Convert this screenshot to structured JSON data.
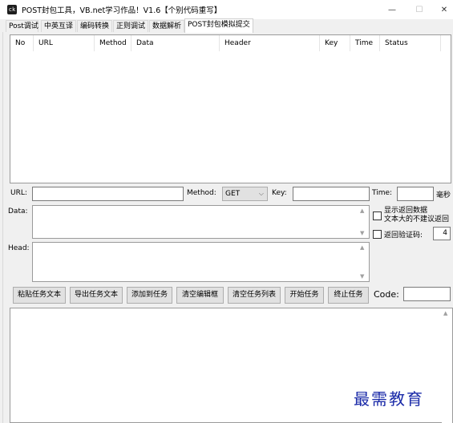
{
  "window": {
    "title": "POST封包工具，VB.net学习作品！V1.6【个别代码重写】",
    "icon_label": "ck",
    "minimize_glyph": "—",
    "maximize_glyph": "☐",
    "close_glyph": "✕"
  },
  "tabs": [
    {
      "label": "Post调试"
    },
    {
      "label": "中英互译"
    },
    {
      "label": "编码转换"
    },
    {
      "label": "正则调试"
    },
    {
      "label": "数据解析"
    },
    {
      "label": "POST封包模拟提交",
      "active": true
    }
  ],
  "task_list": {
    "columns": [
      "No",
      "URL",
      "Method",
      "Data",
      "Header",
      "Key",
      "Time",
      "Status"
    ]
  },
  "request": {
    "url_label": "URL:",
    "url_value": "",
    "method_label": "Method:",
    "method_value": "GET",
    "key_label": "Key:",
    "key_value": "",
    "time_label": "Time:",
    "time_value": "",
    "time_unit": "毫秒",
    "data_label": "Data:",
    "data_value": "",
    "head_label": "Head:",
    "head_value": ""
  },
  "options": {
    "show_return_line1": "显示返回数据",
    "show_return_line2": "文本大的不建议返回",
    "show_return_checked": false,
    "return_captcha_label": "返回验证码:",
    "return_captcha_checked": false,
    "captcha_count": "4"
  },
  "buttons": {
    "paste_task": "粘贴任务文本",
    "export_task": "导出任务文本",
    "add_task": "添加到任务",
    "clear_editor": "清空编辑框",
    "clear_list": "清空任务列表",
    "start": "开始任务",
    "stop": "终止任务"
  },
  "code": {
    "label": "Code:",
    "value": ""
  },
  "output": {
    "value": ""
  },
  "watermark": "最需教育",
  "colors": {
    "window_bg": "#f0f0f0",
    "button_bg": "#e1e1e1",
    "watermark": "#1a2aa8"
  }
}
